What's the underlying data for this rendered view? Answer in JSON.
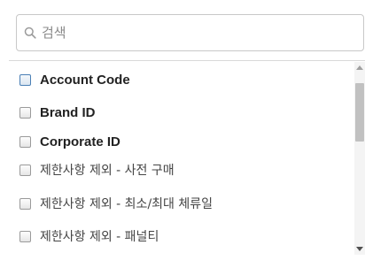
{
  "search": {
    "placeholder": "검색",
    "value": ""
  },
  "options": [
    {
      "label": "Account Code",
      "checked": false,
      "focused": true
    },
    {
      "label": "Brand ID",
      "checked": false
    },
    {
      "label": "Corporate ID",
      "checked": false
    },
    {
      "label": "제한사항 제외 - 사전 구매",
      "checked": false
    },
    {
      "label": "제한사항 제외 - 최소/최대 체류일",
      "checked": false
    },
    {
      "label": "제한사항 제외 - 패널티",
      "checked": false
    }
  ],
  "colors": {
    "focused_checkbox_border": "#4a7fb5",
    "checkbox_border": "#9a9a9a",
    "text": "#333333"
  }
}
